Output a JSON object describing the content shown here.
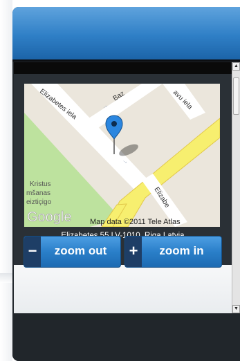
{
  "map": {
    "streets": {
      "elizabetes_top": "Elizabetes iela",
      "baz": "Baz",
      "vu_iela": "avu iela",
      "elizabetes_right": "Elizabe"
    },
    "poi": [
      "Kristus",
      "mšanas",
      "eiztiçigo"
    ],
    "google_logo": "Google",
    "attribution": "Map data ©2011 Tele Atlas",
    "address": "Elizabetes 55,LV-1010 ,Riga,Latvia"
  },
  "controls": {
    "zoom_out_sign": "−",
    "zoom_out_label": "zoom out",
    "zoom_in_sign": "+",
    "zoom_in_label": "zoom in"
  },
  "scrollbar": {
    "up_arrow": "▲",
    "down_arrow": "▼"
  },
  "colors": {
    "header_blue": "#2f7fc6",
    "button_blue": "#2a7fc9",
    "park_green": "#bde29e",
    "main_road": "#f7ef6f"
  }
}
